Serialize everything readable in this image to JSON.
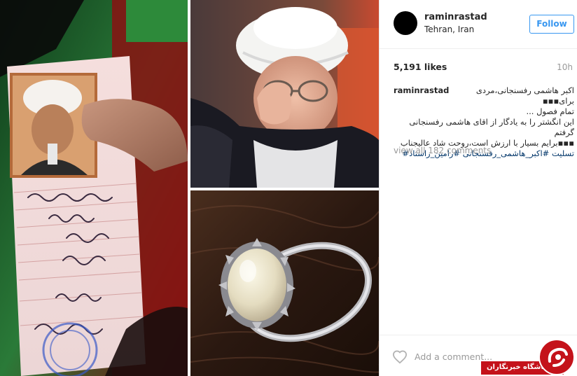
{
  "post": {
    "username": "raminrastad",
    "location": "Tehran, Iran",
    "follow_label": "Follow",
    "likes": "5,191 likes",
    "time_ago": "10h",
    "caption": {
      "username": "raminrastad",
      "line1": "اکبر هاشمی رفسنجانی،مردی برای▪▪▪",
      "line2": "تمام فصول ...",
      "line3": "این انگشتر را به یادگار از اقای هاشمی رفسنجانی گرفتم",
      "line4": "▪▪▪برایم بسیار با ارزش است،روحت شاد عالیجناب",
      "hashtags": "تسلیت #اکبر_هاشمی_رفسنجانی #رامین_راستاد#"
    },
    "view_all_comments": "view all 182 comments",
    "add_comment_placeholder": "Add a comment...",
    "heart_icon": "heart-outline-icon"
  },
  "photos": {
    "id_card": {
      "text_line1": "هزار و سیصد و سیزده",
      "text_line2": "۱۳۱۳",
      "text_line3": "تهران",
      "text_line4": "تهران",
      "text_line5": "۱۳۱۵",
      "text_line6": "تهران",
      "text_line7": "سال"
    }
  },
  "watermark": {
    "text": "باشگاه خبرنگاران",
    "brand_color": "#c4121a"
  },
  "colors": {
    "accent": "#3897f0",
    "muted": "#999999",
    "hashtag": "#003569"
  }
}
